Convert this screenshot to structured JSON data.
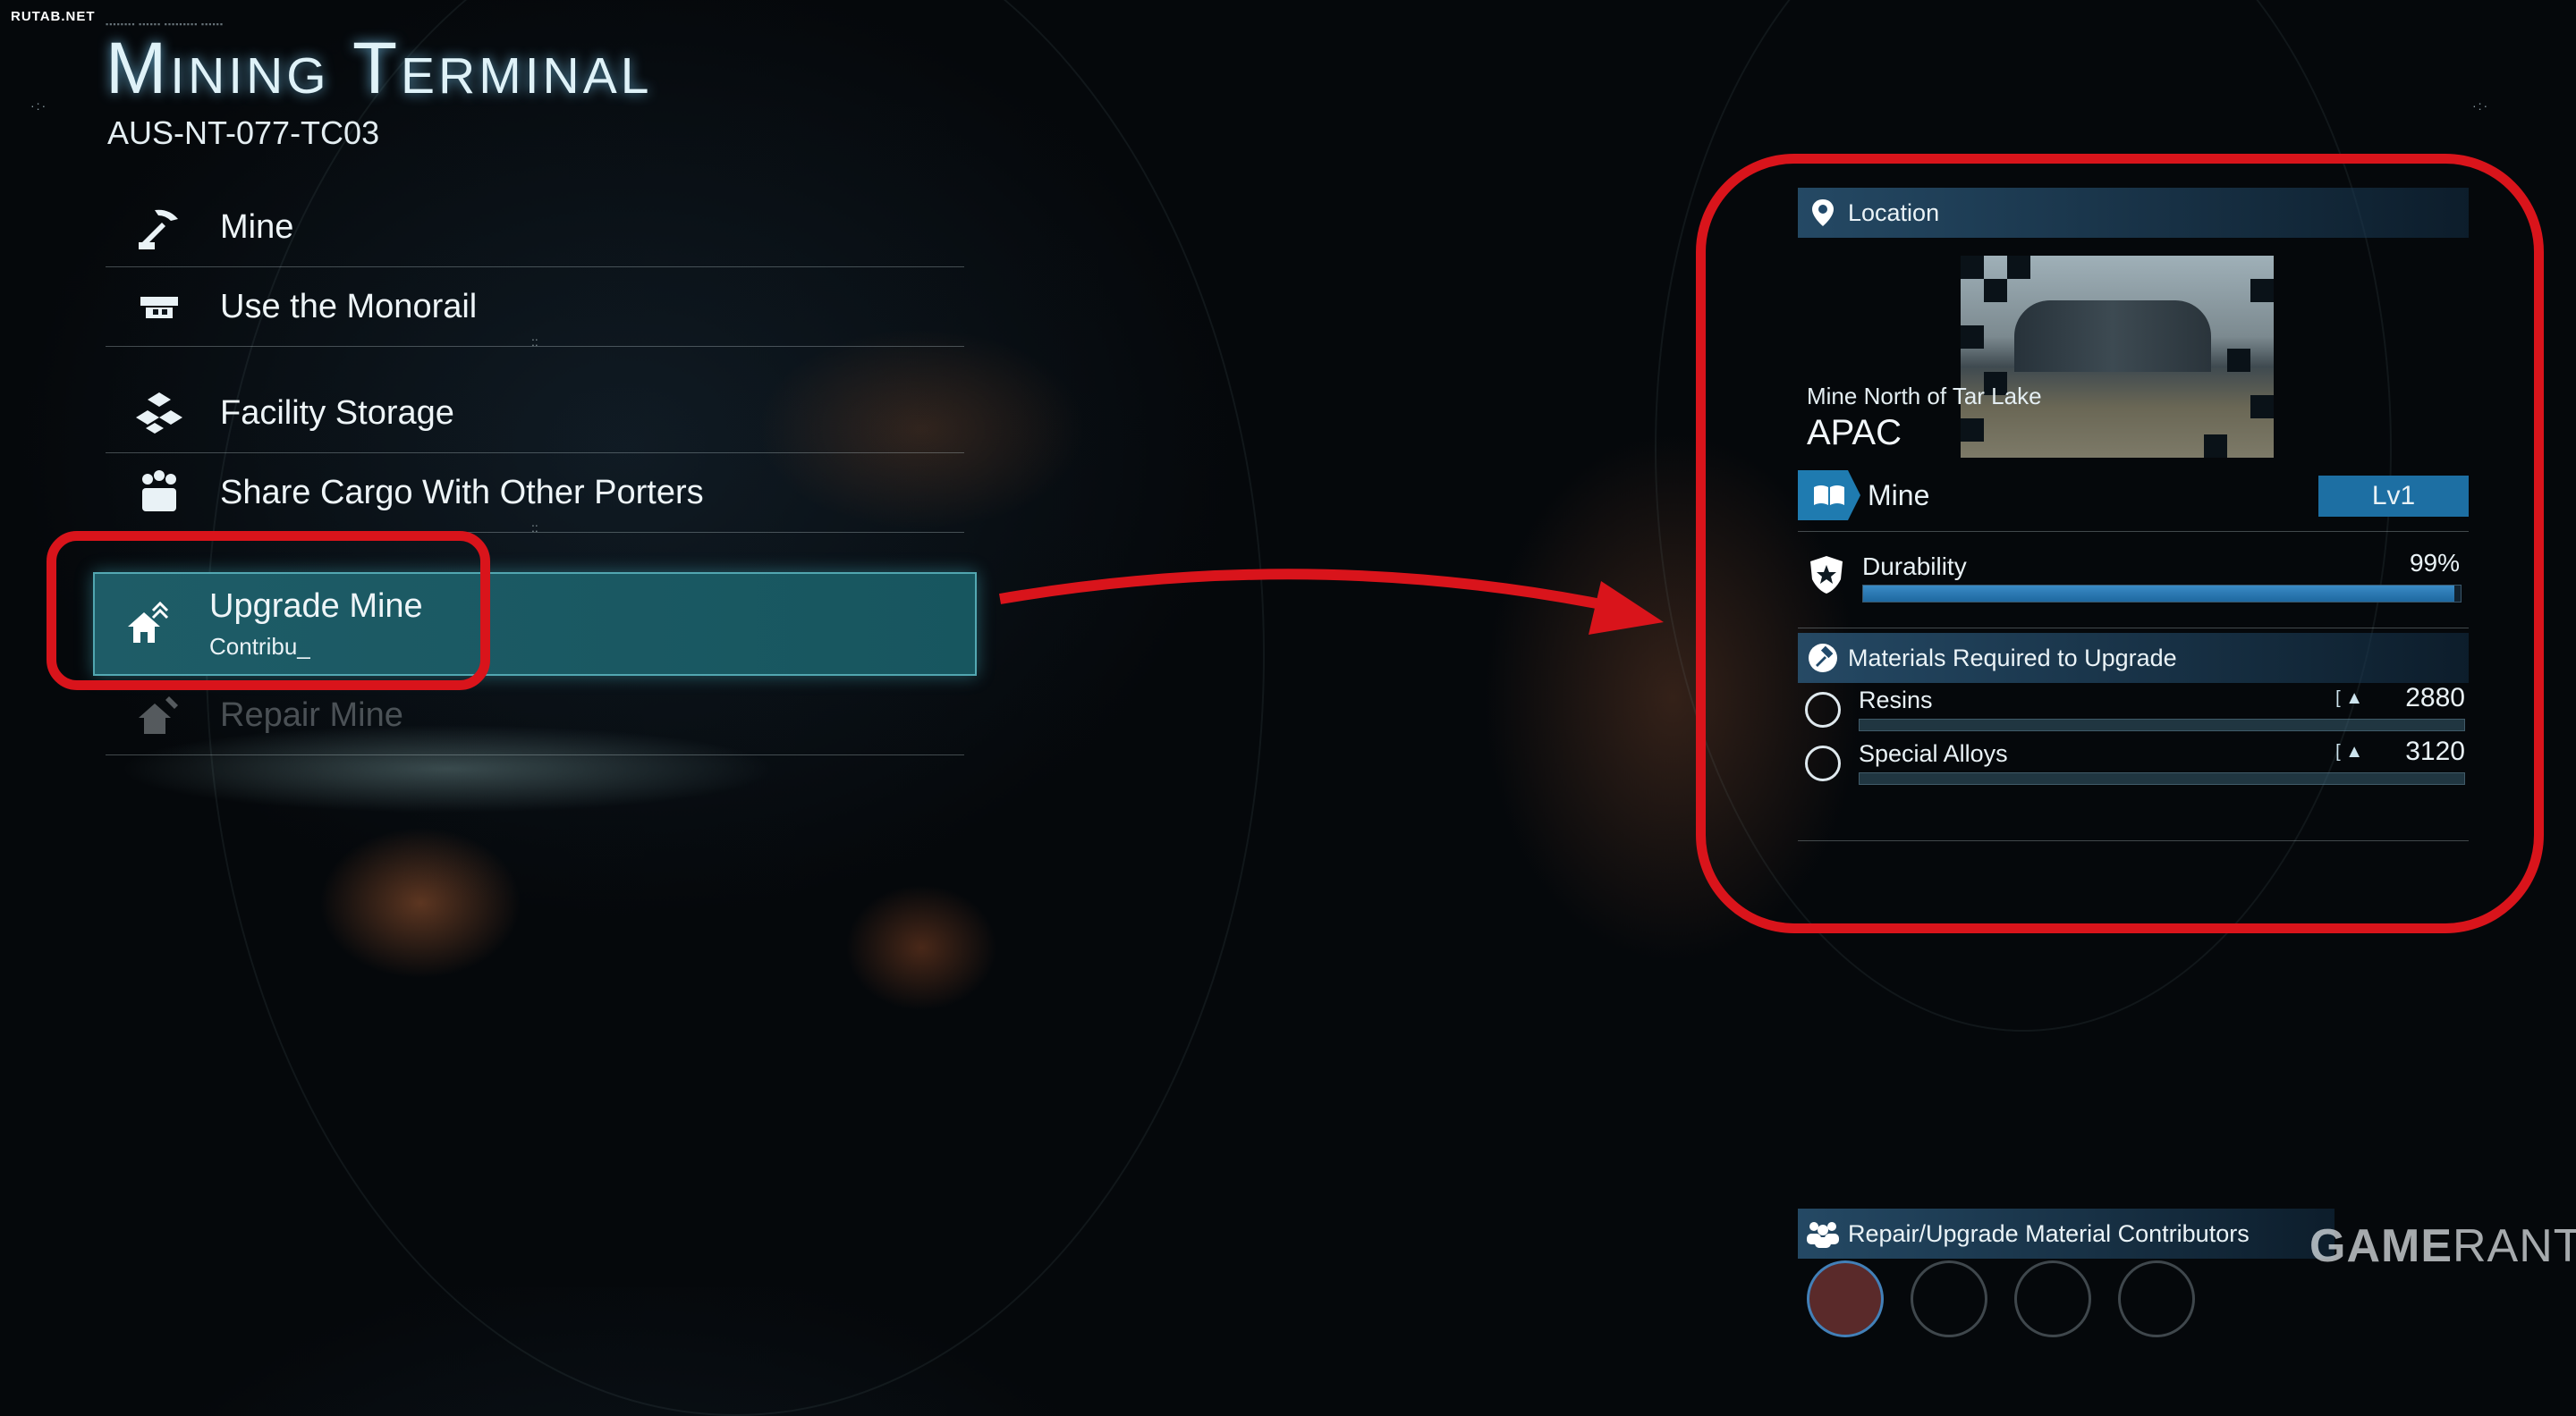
{
  "watermark": "RUTAB.NET",
  "title": "Mining Terminal",
  "terminal_id": "AUS-NT-077-TC03",
  "menu": {
    "items": [
      {
        "label": "Mine",
        "icon": "pickaxe-icon"
      },
      {
        "label": "Use the Monorail",
        "icon": "monorail-icon"
      },
      {
        "label": "Facility Storage",
        "icon": "storage-icon"
      },
      {
        "label": "Share Cargo With Other Porters",
        "icon": "share-cargo-icon"
      },
      {
        "label": "Upgrade Mine",
        "sub": "Contribu_",
        "icon": "upgrade-house-icon",
        "selected": true
      },
      {
        "label": "Repair Mine",
        "icon": "repair-house-icon",
        "disabled": true
      }
    ]
  },
  "panel": {
    "location_header": "Location",
    "location_name": "Mine North of Tar Lake",
    "region": "APAC",
    "facility_type": "Mine",
    "level": "Lv1",
    "durability_label": "Durability",
    "durability_value": "99%",
    "durability_fraction": 0.99,
    "materials_header": "Materials Required to Upgrade",
    "materials": [
      {
        "name": "Resins",
        "amount": "2880"
      },
      {
        "name": "Special Alloys",
        "amount": "3120"
      }
    ],
    "contributors_header": "Repair/Upgrade Material Contributors"
  },
  "logo": {
    "game": "GAME",
    "rant": "RANT"
  },
  "colors": {
    "highlight": "#d9141b",
    "accent": "#1f7bb0",
    "selected": "#1e5c67"
  }
}
